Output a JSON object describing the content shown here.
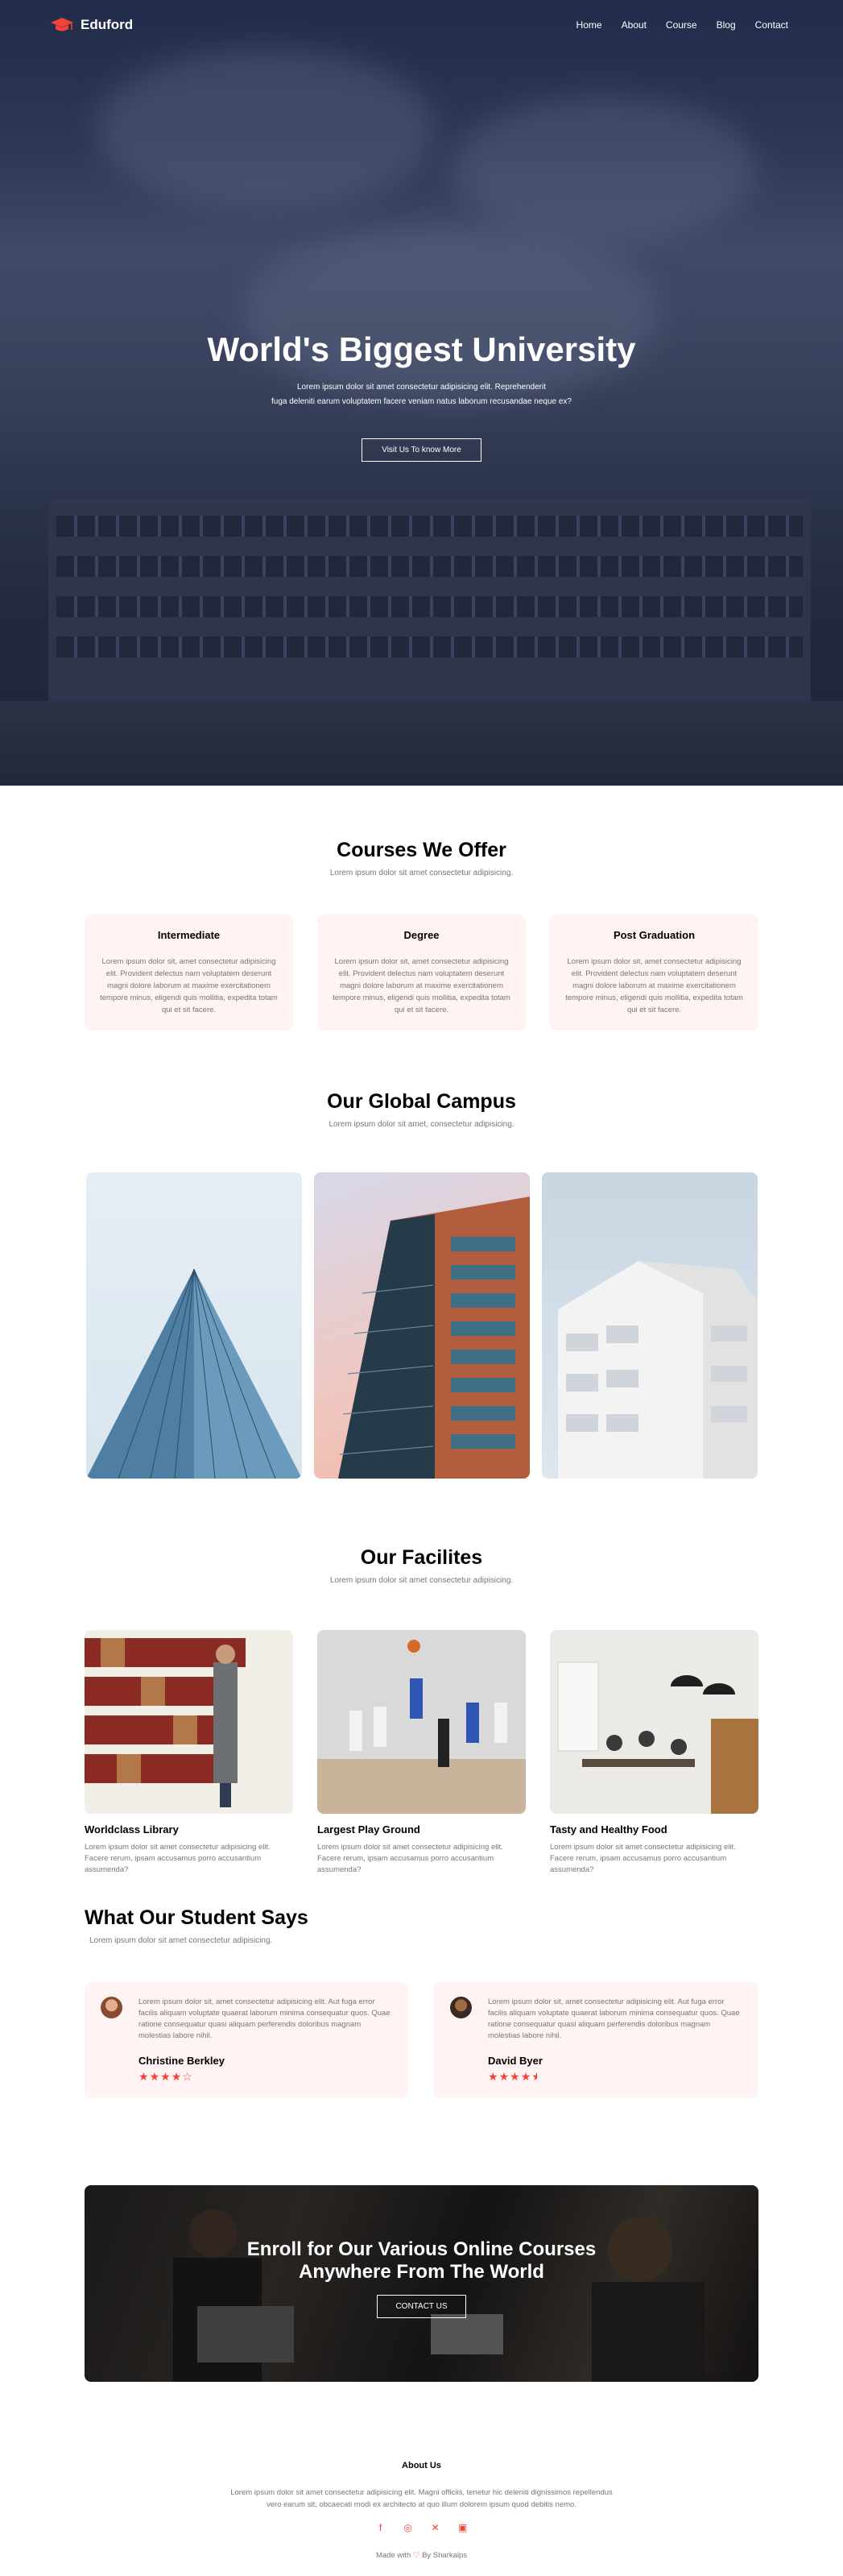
{
  "brand": {
    "name": "Eduford",
    "accent": "#f44336",
    "logo_icon": "graduation-cap-icon"
  },
  "nav": {
    "items": [
      "Home",
      "About",
      "Course",
      "Blog",
      "Contact"
    ]
  },
  "hero": {
    "title": "World's Biggest University",
    "line1": "Lorem ipsum dolor sit amet consectetur adipisicing elit. Reprehenderit",
    "line2": "fuga deleniti earum voluptatem facere veniam natus laborum recusandae neque ex?",
    "button": "Visit Us To know More"
  },
  "courses": {
    "title": "Courses We Offer",
    "subtitle": "Lorem ipsum dolor sit amet consectetur adipisicing.",
    "cards": [
      {
        "title": "Intermediate",
        "text": "Lorem ipsum dolor sit, amet consectetur adipisicing elit. Provident delectus nam voluptatem deserunt magni dolore laborum at maxime exercitationem tempore minus, eligendi quis mollitia, expedita totam qui et sit facere."
      },
      {
        "title": "Degree",
        "text": "Lorem ipsum dolor sit, amet consectetur adipisicing elit. Provident delectus nam voluptatem deserunt magni dolore laborum at maxime exercitationem tempore minus, eligendi quis mollitia, expedita totam qui et sit facere."
      },
      {
        "title": "Post Graduation",
        "text": "Lorem ipsum dolor sit, amet consectetur adipisicing elit. Provident delectus nam voluptatem deserunt magni dolore laborum at maxime exercitationem tempore minus, eligendi quis mollitia, expedita totam qui et sit facere."
      }
    ]
  },
  "campus": {
    "title": "Our Global Campus",
    "subtitle": "Lorem ipsum dolor sit amet, consectetur adipisicing."
  },
  "facilities": {
    "title": "Our Facilites",
    "subtitle": "Lorem ipsum dolor sit amet consectetur adipisicing.",
    "items": [
      {
        "title": "Worldclass Library",
        "text": "Lorem ipsum dolor sit amet consectetur adipisicing elit. Facere rerum, ipsam accusamus porro accusantium assumenda?"
      },
      {
        "title": "Largest Play Ground",
        "text": "Lorem ipsum dolor sit amet consectetur adipisicing elit. Facere rerum, ipsam accusamus porro accusantium assumenda?"
      },
      {
        "title": "Tasty and Healthy Food",
        "text": "Lorem ipsum dolor sit amet consectetur adipisicing elit. Facere rerum, ipsam accusamus porro accusantium assumenda?"
      }
    ]
  },
  "testimonials": {
    "title": "What Our Student Says",
    "subtitle": "Lorem ipsum dolor sit amet consectetur adipisicing.",
    "items": [
      {
        "text": "Lorem ipsum dolor sit, amet consectetur adipisicing elit. Aut fuga error facilis aliquam voluptate quaerat laborum minima consequatur quos. Quae ratione consequatur quasi aliquam perferendis doloribus magnam molestias labore nihil.",
        "name": "Christine Berkley",
        "rating": 4
      },
      {
        "text": "Lorem ipsum dolor sit, amet consectetur adipisicing elit. Aut fuga error facilis aliquam voluptate quaerat laborum minima consequatur quos. Quae ratione consequatur quasi aliquam perferendis doloribus magnam molestias labore nihil.",
        "name": "David Byer",
        "rating": 4.5
      }
    ]
  },
  "cta": {
    "line1": "Enroll for Our Various Online Courses",
    "line2": "Anywhere From The World",
    "button": "CONTACT US"
  },
  "footer": {
    "title": "About Us",
    "line1": "Lorem ipsum dolor sit amet consectetur adipisicing elit. Magni officiis, tenetur hic deleniti dignissimos repellendus",
    "line2": "vero earum sit, obcaecati modi ex architecto at quo illum dolorem ipsum quod debitis nemo.",
    "socials": [
      "facebook-icon",
      "instagram-icon",
      "x-icon",
      "linkedin-icon"
    ],
    "made_prefix": "Made with",
    "made_suffix": "By Sharkalps"
  }
}
